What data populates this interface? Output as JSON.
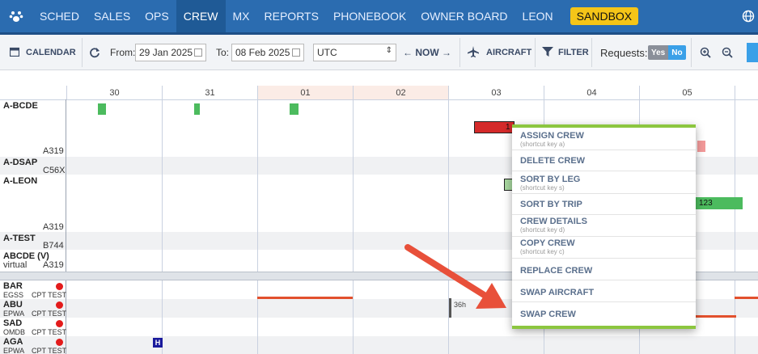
{
  "nav": {
    "items": [
      "SCHED",
      "SALES",
      "OPS",
      "CREW",
      "MX",
      "REPORTS",
      "PHONEBOOK",
      "OWNER BOARD",
      "LEON"
    ],
    "sandbox": "SANDBOX"
  },
  "toolbar": {
    "calendar": "CALENDAR",
    "from_label": "From:",
    "from_value": "29 Jan 2025",
    "to_label": "To:",
    "to_value": "08 Feb 2025",
    "timezone": "UTC",
    "now": "← NOW →",
    "aircraft": "AIRCRAFT",
    "filter": "FILTER",
    "requests_label": "Requests:",
    "yes": "Yes",
    "no": "No"
  },
  "timeline": {
    "days": [
      "30",
      "31",
      "01",
      "02",
      "03",
      "04",
      "05"
    ],
    "aircraft_rows": [
      {
        "reg": "A-BCDE",
        "type": "A319"
      },
      {
        "reg": "A-DSAP",
        "type": "C56X"
      },
      {
        "reg": "A-LEON",
        "type": "A319"
      },
      {
        "reg": "A-TEST",
        "type": "B744"
      },
      {
        "reg": "ABCDE (V)",
        "type": "A319",
        "note": "virtual"
      }
    ],
    "trip_labels": {
      "red_trip": "1",
      "green_trip": "123"
    },
    "crew_rows": [
      {
        "code": "BAR",
        "base": "EGSS",
        "role": "CPT TEST"
      },
      {
        "code": "ABU",
        "base": "EPWA",
        "role": "CPT TEST"
      },
      {
        "code": "SAD",
        "base": "OMDB",
        "role": "CPT TEST"
      },
      {
        "code": "AGA",
        "base": "EPWA",
        "role": "CPT TEST"
      }
    ],
    "rest_label": "36h",
    "hotel_label": "H"
  },
  "context_menu": {
    "items": [
      {
        "label": "ASSIGN CREW",
        "hint": "(shortcut key a)"
      },
      {
        "label": "DELETE CREW",
        "hint": ""
      },
      {
        "label": "SORT BY LEG",
        "hint": "(shortcut key s)"
      },
      {
        "label": "SORT BY TRIP",
        "hint": ""
      },
      {
        "label": "CREW DETAILS",
        "hint": "(shortcut key d)"
      },
      {
        "label": "COPY CREW",
        "hint": "(shortcut key c)"
      },
      {
        "label": "REPLACE CREW",
        "hint": ""
      },
      {
        "label": "SWAP AIRCRAFT",
        "hint": ""
      },
      {
        "label": "SWAP CREW",
        "hint": ""
      }
    ]
  },
  "colors": {
    "nav_bg": "#2b6cb0",
    "sandbox": "#f5c518",
    "menu_accent": "#8cc63f",
    "arrow": "#e8503a",
    "trip_green": "#4cbb5e",
    "trip_red": "#d42a2a"
  }
}
